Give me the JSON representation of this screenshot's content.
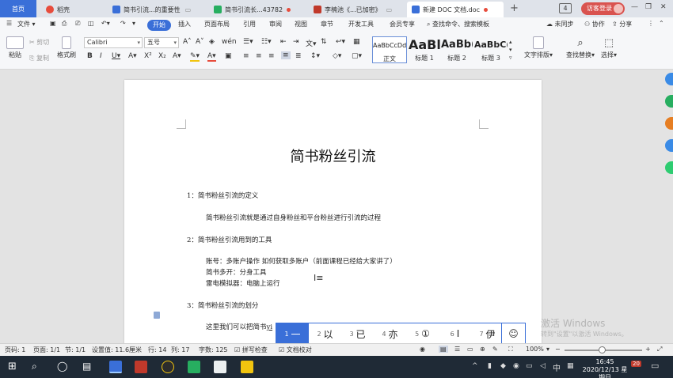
{
  "tabs": [
    {
      "label": "首页"
    },
    {
      "label": "稻壳"
    },
    {
      "label": "简书引流...的重要性"
    },
    {
      "label": "简书引流长...43782"
    },
    {
      "label": "李楠池《...已加密》"
    },
    {
      "label": "新建 DOC 文档.doc"
    }
  ],
  "header": {
    "tab_count": "4",
    "login": "访客登录"
  },
  "menu": {
    "file": "文件",
    "items": [
      "开始",
      "插入",
      "页面布局",
      "引用",
      "审阅",
      "视图",
      "章节",
      "开发工具",
      "会员专享"
    ],
    "search": "查找命令、搜索模板",
    "sync": "未同步",
    "collab": "协作",
    "share": "分享"
  },
  "ribbon": {
    "paste": "粘贴",
    "cut": "剪切",
    "copy": "复制",
    "format_painter": "格式刷",
    "font": "Calibri",
    "size": "五号",
    "styles": [
      {
        "preview": "AaBbCcDd",
        "label": "正文"
      },
      {
        "preview": "AaBl",
        "label": "标题 1"
      },
      {
        "preview": "AaBb(",
        "label": "标题 2"
      },
      {
        "preview": "AaBbC(",
        "label": "标题 3"
      }
    ],
    "text_layout": "文字排版",
    "find_replace": "查找替换",
    "select": "选择"
  },
  "document": {
    "title": "简书粉丝引流",
    "lines": [
      "1：简书粉丝引流的定义",
      "简书粉丝引流就是通过自身粉丝和平台粉丝进行引流的过程",
      "2：简书粉丝引流用到的工具",
      "账号：多账户操作     如何获取多账户（前面课程已经给大家讲了）",
      "简书多开：分身工具",
      "雷电模拟器：电脑上运行",
      "3：简书粉丝引流的划分",
      "这里我们可以把简书"
    ],
    "typing": "yi"
  },
  "ime": {
    "candidates": [
      {
        "num": "1",
        "char": "一"
      },
      {
        "num": "2",
        "char": "以"
      },
      {
        "num": "3",
        "char": "已"
      },
      {
        "num": "4",
        "char": "亦"
      },
      {
        "num": "5",
        "char": "①"
      },
      {
        "num": "6",
        "char": "Ⅰ"
      },
      {
        "num": "7",
        "char": "伊"
      }
    ],
    "emoji": "☺"
  },
  "watermark": {
    "line1": "激活 Windows",
    "line2": "转到\"设置\"以激活 Windows。"
  },
  "status": {
    "page": "页码: 1",
    "pages": "页面: 1/1",
    "section": "节: 1/1",
    "settings": "设置值: 11.6厘米",
    "row": "行: 14",
    "col": "列: 17",
    "words": "字数: 125",
    "spell": "拼写检查",
    "compare": "文档校对",
    "zoom": "100%"
  },
  "taskbar": {
    "time": "16:45",
    "date": "2020/12/13 星期日",
    "ime": "中",
    "notif": "20"
  }
}
